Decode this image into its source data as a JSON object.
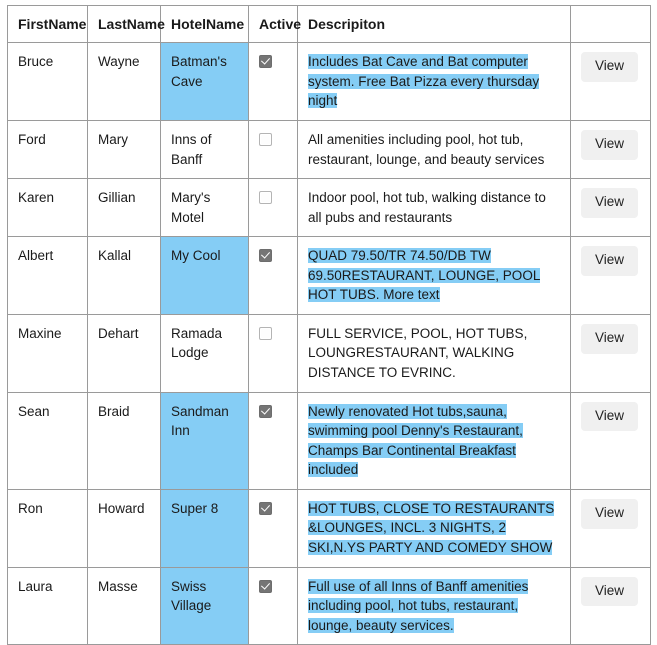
{
  "table": {
    "columns": [
      {
        "key": "first_name",
        "label": "FirstName"
      },
      {
        "key": "last_name",
        "label": "LastName"
      },
      {
        "key": "hotel_name",
        "label": "HotelName"
      },
      {
        "key": "active",
        "label": "Active"
      },
      {
        "key": "description",
        "label": "Descripiton"
      },
      {
        "key": "action",
        "label": ""
      }
    ],
    "action_label": "View",
    "selection_color": "#85cdf5",
    "rows": [
      {
        "first_name": "Bruce",
        "last_name": "Wayne",
        "hotel_name": "Batman's Cave",
        "hotel_selected": true,
        "active": true,
        "description": "Includes Bat Cave and Bat computer system. Free Bat Pizza every thursday night",
        "description_selected": true,
        "action": "View"
      },
      {
        "first_name": "Ford",
        "last_name": "Mary",
        "hotel_name": "Inns of Banff",
        "hotel_selected": false,
        "active": false,
        "description": "All amenities including pool, hot tub, restaurant, lounge, and beauty services",
        "description_selected": false,
        "action": "View"
      },
      {
        "first_name": "Karen",
        "last_name": "Gillian",
        "hotel_name": "Mary's Motel",
        "hotel_selected": false,
        "active": false,
        "description": "Indoor pool, hot tub, walking distance to all pubs and restaurants",
        "description_selected": false,
        "action": "View"
      },
      {
        "first_name": "Albert",
        "last_name": "Kallal",
        "hotel_name": "My Cool",
        "hotel_selected": true,
        "active": true,
        "description": "QUAD 79.50/TR 74.50/DB TW 69.50RESTAURANT, LOUNGE, POOL HOT TUBS. More text",
        "description_selected": true,
        "action": "View"
      },
      {
        "first_name": "Maxine",
        "last_name": "Dehart",
        "hotel_name": "Ramada Lodge",
        "hotel_selected": false,
        "active": false,
        "description": "FULL SERVICE, POOL, HOT TUBS, LOUNGRESTAURANT, WALKING DISTANCE TO EVRINC.",
        "description_selected": false,
        "action": "View"
      },
      {
        "first_name": "Sean",
        "last_name": "Braid",
        "hotel_name": "Sandman Inn",
        "hotel_selected": true,
        "active": true,
        "description": "Newly renovated Hot tubs,sauna, swimming pool Denny's Restaurant, Champs Bar Continental Breakfast included",
        "description_selected": true,
        "action": "View"
      },
      {
        "first_name": "Ron",
        "last_name": "Howard",
        "hotel_name": "Super 8",
        "hotel_selected": true,
        "active": true,
        "description": "HOT TUBS, CLOSE TO RESTAURANTS &LOUNGES, INCL. 3 NIGHTS, 2 SKI,N.YS PARTY AND COMEDY SHOW",
        "description_selected": true,
        "action": "View"
      },
      {
        "first_name": "Laura",
        "last_name": "Masse",
        "hotel_name": "Swiss Village",
        "hotel_selected": true,
        "active": true,
        "description": "Full use of all Inns of Banff amenities including pool, hot tubs, restaurant, lounge, beauty services.",
        "description_selected": true,
        "action": "View"
      }
    ]
  }
}
